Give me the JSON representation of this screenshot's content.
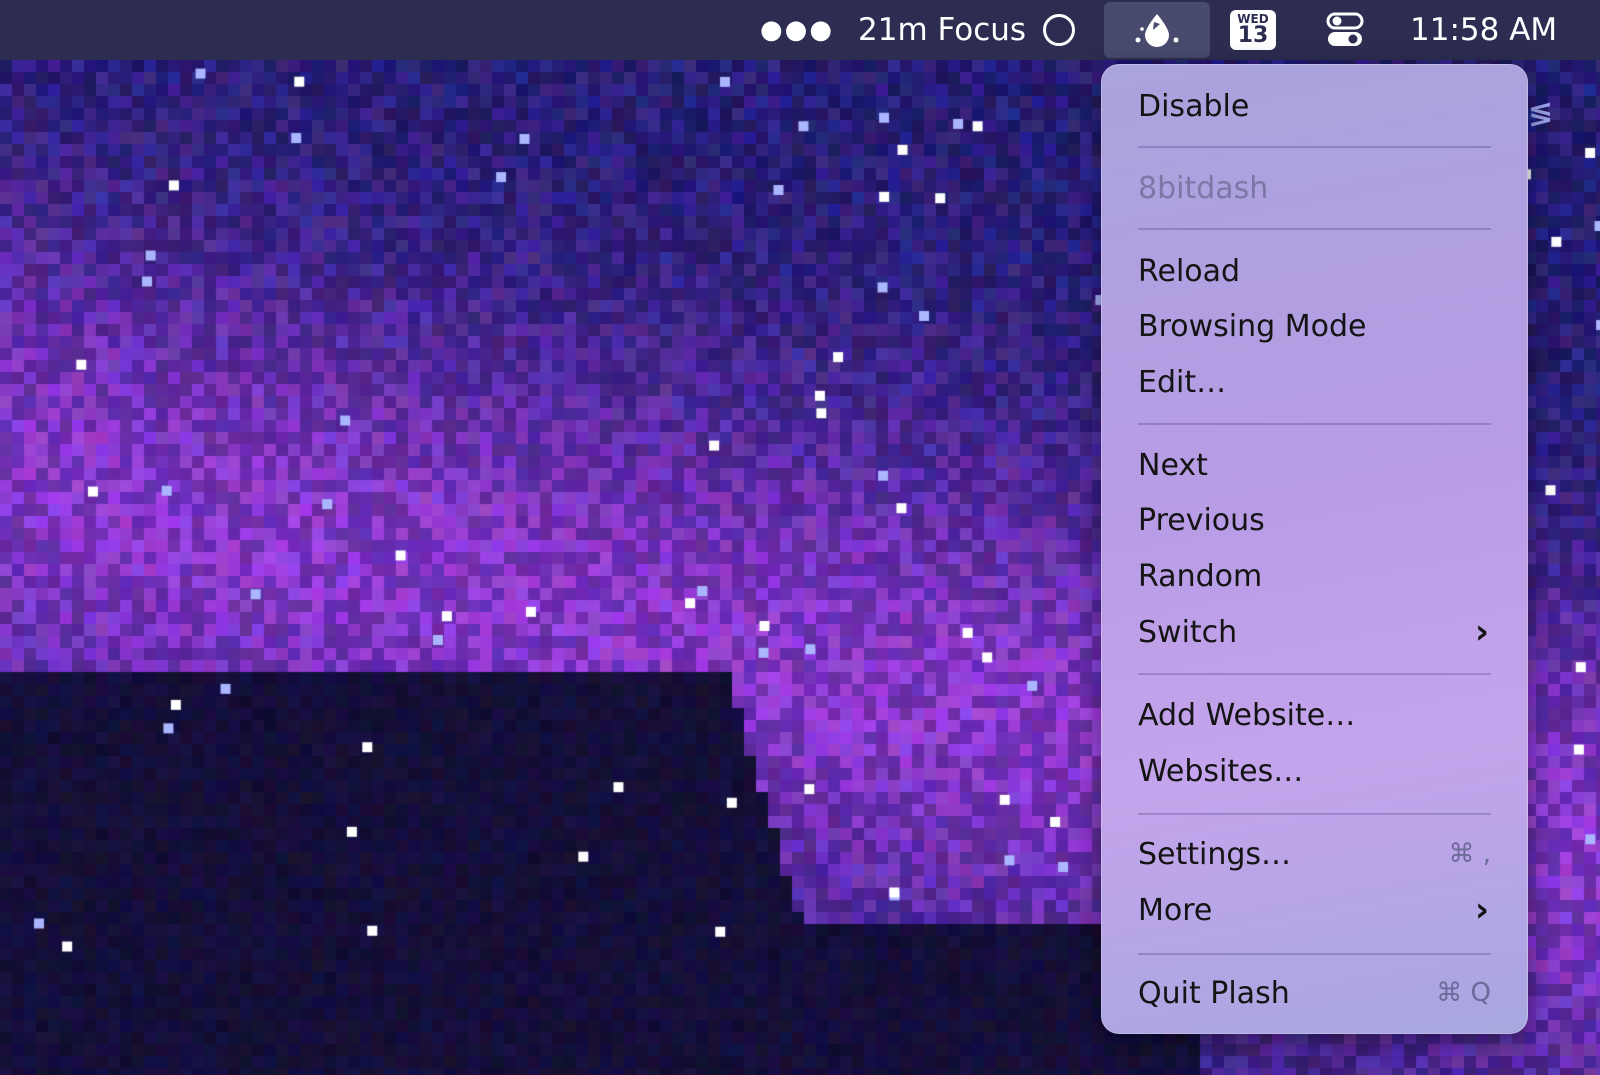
{
  "menubar": {
    "more_icon": "ellipsis-icon",
    "focus_label": "21m Focus",
    "focus_icon": "focus-ring-icon",
    "plash_icon": "droplet-icon",
    "calendar_day": "WED",
    "calendar_date": "13",
    "control_center_icon": "toggle-icon",
    "clock": "11:58 AM"
  },
  "menu": {
    "disable": "Disable",
    "current_site": "8bitdash",
    "reload": "Reload",
    "browsing_mode": "Browsing Mode",
    "edit": "Edit…",
    "next": "Next",
    "previous": "Previous",
    "random": "Random",
    "switch": "Switch",
    "add_website": "Add Website…",
    "websites": "Websites…",
    "settings": "Settings…",
    "settings_shortcut": "⌘ ,",
    "more": "More",
    "quit": "Quit Plash",
    "quit_shortcut": "⌘ Q"
  },
  "colors": {
    "menubar_bg": "#2d2d52",
    "wallpaper_dark": "#120c3a",
    "wallpaper_purple": "#7b3fd4",
    "wallpaper_blue": "#2a3aa8"
  }
}
